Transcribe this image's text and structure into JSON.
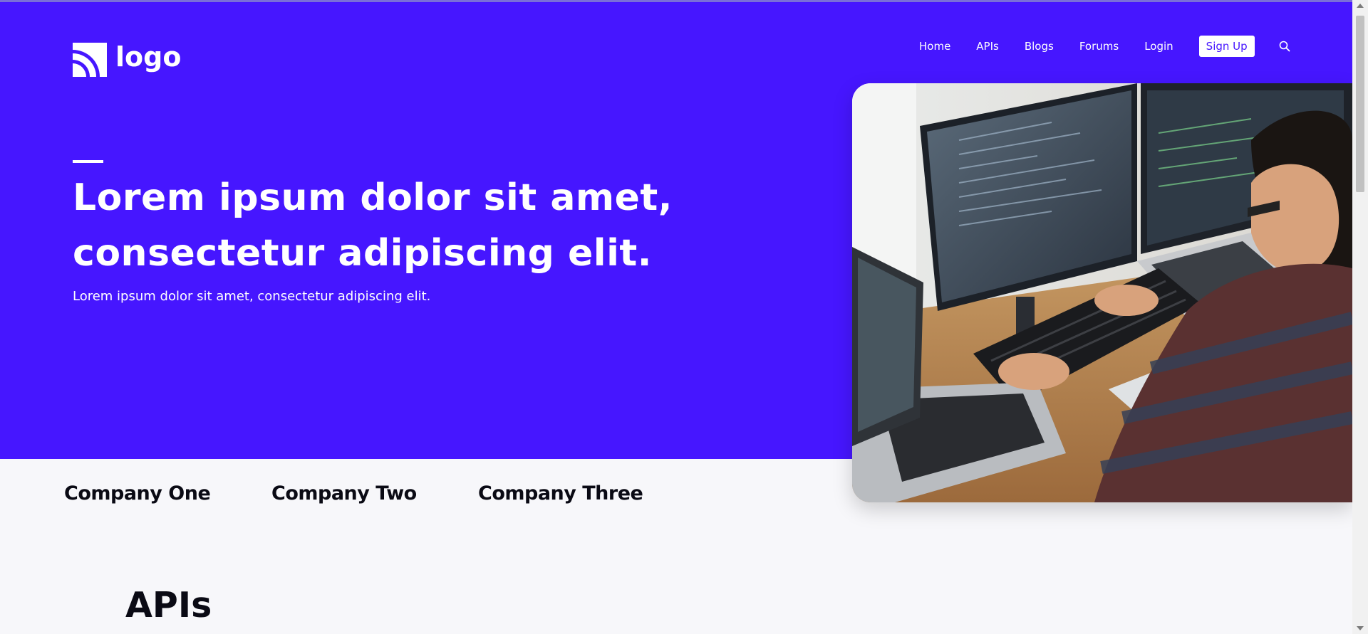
{
  "brand": {
    "logo_text": "logo",
    "logo_icon": "rss-icon",
    "accent_color": "#4616ff"
  },
  "nav": {
    "items": [
      {
        "label": "Home"
      },
      {
        "label": "APIs"
      },
      {
        "label": "Blogs"
      },
      {
        "label": "Forums"
      },
      {
        "label": "Login"
      }
    ],
    "signup_label": "Sign Up",
    "search_icon": "search-icon"
  },
  "hero": {
    "headline_line1": "Lorem ipsum dolor sit amet,",
    "headline_line2": "consectetur adipiscing elit.",
    "subtext": "Lorem ipsum dolor sit amet, consectetur adipiscing elit.",
    "image": "developer-at-computers-photo"
  },
  "companies": [
    "Company One",
    "Company Two",
    "Company Three"
  ],
  "apis_section": {
    "title": "APIs"
  }
}
